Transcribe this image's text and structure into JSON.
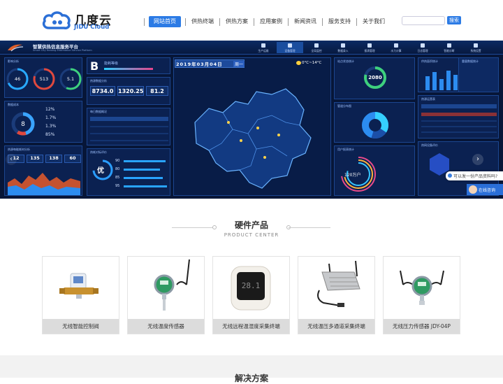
{
  "header": {
    "logo_cn": "几度云",
    "logo_en": "JIDU Cloud",
    "nav": [
      {
        "label": "网站首页",
        "active": true
      },
      {
        "label": "供热终端",
        "active": false
      },
      {
        "label": "供热方案",
        "active": false
      },
      {
        "label": "应用案例",
        "active": false
      },
      {
        "label": "新闻资讯",
        "active": false
      },
      {
        "label": "服务支持",
        "active": false
      },
      {
        "label": "关于我们",
        "active": false
      }
    ],
    "search_placeholder": "",
    "search_button": "搜索"
  },
  "banner": {
    "title": "智慧供热信息服务平台",
    "subtitle": "Smart City Heating Information Service Platform",
    "menu": [
      "生产运维",
      "设备管理",
      "全局监控",
      "数据录入",
      "报表管理",
      "水力计算",
      "日志管理",
      "智能诊断",
      "系统设置"
    ],
    "date": "2019年03月04日",
    "weekday": "周一",
    "weather": "0°C~14°C",
    "panels": {
      "p1_title": "影响分析",
      "p1_values": [
        "46",
        "513",
        "5.1"
      ],
      "p2_title": "能耗等级",
      "p2_grade": "B",
      "p3_title": "热源数据分析",
      "p3_values": [
        "8734.0",
        "1320.25",
        "81.2"
      ],
      "p4_title": "每日数据概况",
      "p5_title": "数据成本",
      "p5_center": "8",
      "p5_pcts": [
        "12%",
        "1.7%",
        "1.3%",
        "85%"
      ],
      "p6_title": "热源每能耗材分析",
      "p6_values": [
        "12",
        "135",
        "138",
        "60"
      ],
      "p7_title": "热耗对标评价",
      "p7_grade": "优",
      "p7_bars": [
        "90",
        "80",
        "85",
        "95"
      ],
      "r1_title": "站点状态统计",
      "r1_value": "2080",
      "r2_title": "管道分布图",
      "r3_title": "用户报表统计",
      "r3_value": "120万户",
      "r4_title": "供热面积统计",
      "r5_title": "重量数据统计",
      "r6_title": "热源运营表",
      "r7_title": "热网设备评价"
    },
    "chat_text": "可以发一份产品资料吗?",
    "consult_text": "在线咨询",
    "arrow_left": "‹",
    "arrow_right": "›"
  },
  "products": {
    "title": "硬件产品",
    "subtitle": "PRODUCT CENTER",
    "items": [
      {
        "name": "无线智能控制阀",
        "icon": "valve-icon"
      },
      {
        "name": "无线温度传感器",
        "icon": "temperature-sensor-icon"
      },
      {
        "name": "无线远程温湿度采集终端",
        "icon": "humidity-terminal-icon"
      },
      {
        "name": "无线温压多通道采集终端",
        "icon": "multichannel-terminal-icon"
      },
      {
        "name": "无线压力传感器 JDY-04P",
        "icon": "pressure-sensor-icon"
      }
    ]
  },
  "next_section": {
    "title": "解决方案"
  },
  "colors": {
    "accent": "#2c7be5",
    "banner_bg": "#071638"
  }
}
